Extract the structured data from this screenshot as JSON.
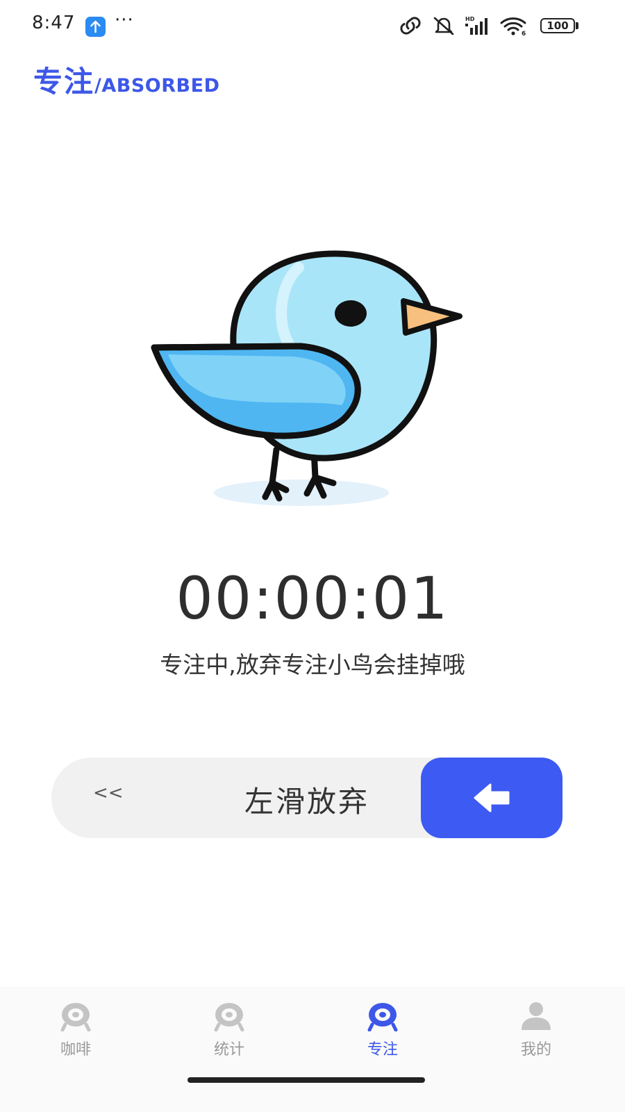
{
  "status_bar": {
    "time": "8:47",
    "more": "···",
    "battery": "100",
    "icons": [
      "upload-icon",
      "link-icon",
      "mute-icon",
      "hd-signal-icon",
      "wifi-icon",
      "battery-icon"
    ]
  },
  "header": {
    "title_cn": "专注",
    "title_en": "/ABSORBED"
  },
  "focus": {
    "timer": "00:00:01",
    "hint": "专注中,放弃专注小鸟会挂掉哦"
  },
  "slider": {
    "chevrons": "<<",
    "label": "左滑放弃",
    "thumb_icon": "arrow-left-icon"
  },
  "nav": {
    "items": [
      {
        "label": "咖啡",
        "icon": "coffee-icon",
        "active": false
      },
      {
        "label": "统计",
        "icon": "stats-icon",
        "active": false
      },
      {
        "label": "专注",
        "icon": "focus-icon",
        "active": true
      },
      {
        "label": "我的",
        "icon": "profile-icon",
        "active": false
      }
    ]
  },
  "colors": {
    "accent": "#3d57e8",
    "slider_thumb": "#3d5af2",
    "inactive_nav": "#999999"
  }
}
